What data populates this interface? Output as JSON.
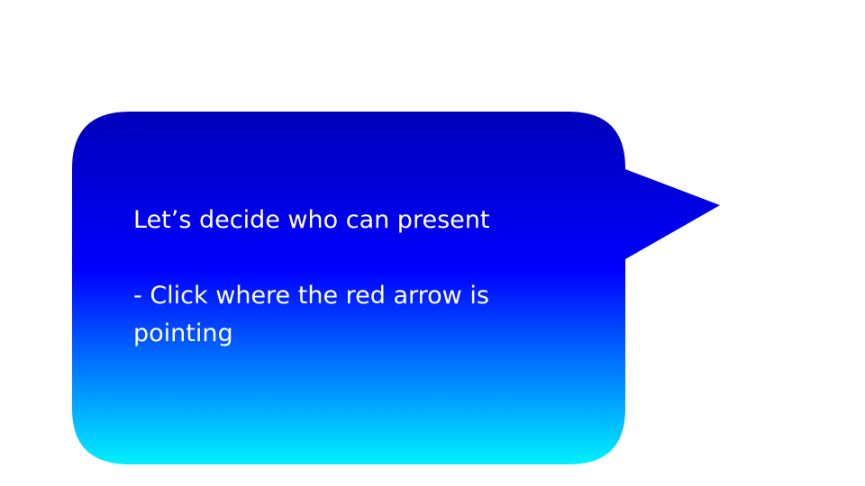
{
  "bubble": {
    "line1": "Let’s decide who can present",
    "line2": "- Click where the red arrow is pointing",
    "gradient_top": "#0000bb",
    "gradient_mid": "#0000ff",
    "gradient_bottom": "#00f0ff"
  }
}
